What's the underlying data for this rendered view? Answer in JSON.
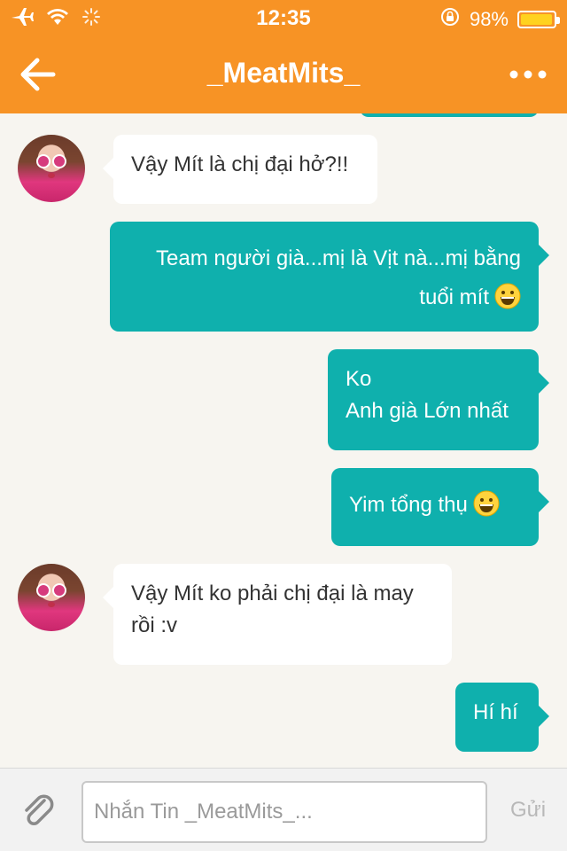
{
  "status_bar": {
    "time": "12:35",
    "battery_percent_label": "98%",
    "battery_level": 0.98,
    "battery_color": "#ffd21f"
  },
  "header": {
    "title": "_MeatMits_",
    "background_color": "#f79325"
  },
  "icons": {
    "status": [
      "airplane-icon",
      "wifi-icon",
      "activity-spinner-icon",
      "rotation-lock-icon",
      "battery-icon"
    ],
    "nav": [
      "back-arrow-icon",
      "more-icon"
    ],
    "input": [
      "paperclip-icon"
    ]
  },
  "messages": [
    {
      "direction": "in",
      "lines": [
        "Vậy Mít là chị đại hở?!!"
      ]
    },
    {
      "direction": "out",
      "lines": [
        "Team người già...mị là Vịt nà...mị bằng",
        "tuổi mít"
      ],
      "emoji": "grinning-face-emoji"
    },
    {
      "direction": "out",
      "lines": [
        "Ko",
        "Anh già Lớn nhất"
      ]
    },
    {
      "direction": "out",
      "lines": [
        "Yim tổng thụ"
      ],
      "emoji": "grinning-face-emoji"
    },
    {
      "direction": "in",
      "lines": [
        "Vậy Mít ko phải chị đại là may",
        "rồi :v"
      ]
    },
    {
      "direction": "out",
      "lines": [
        "Hí hí"
      ]
    }
  ],
  "colors": {
    "outgoing_bubble": "#0fb0ad",
    "incoming_bubble": "#ffffff",
    "chat_background": "#f7f5f0"
  },
  "composer": {
    "placeholder": "Nhắn Tin _MeatMits_...",
    "value": "",
    "send_label": "Gửi"
  }
}
